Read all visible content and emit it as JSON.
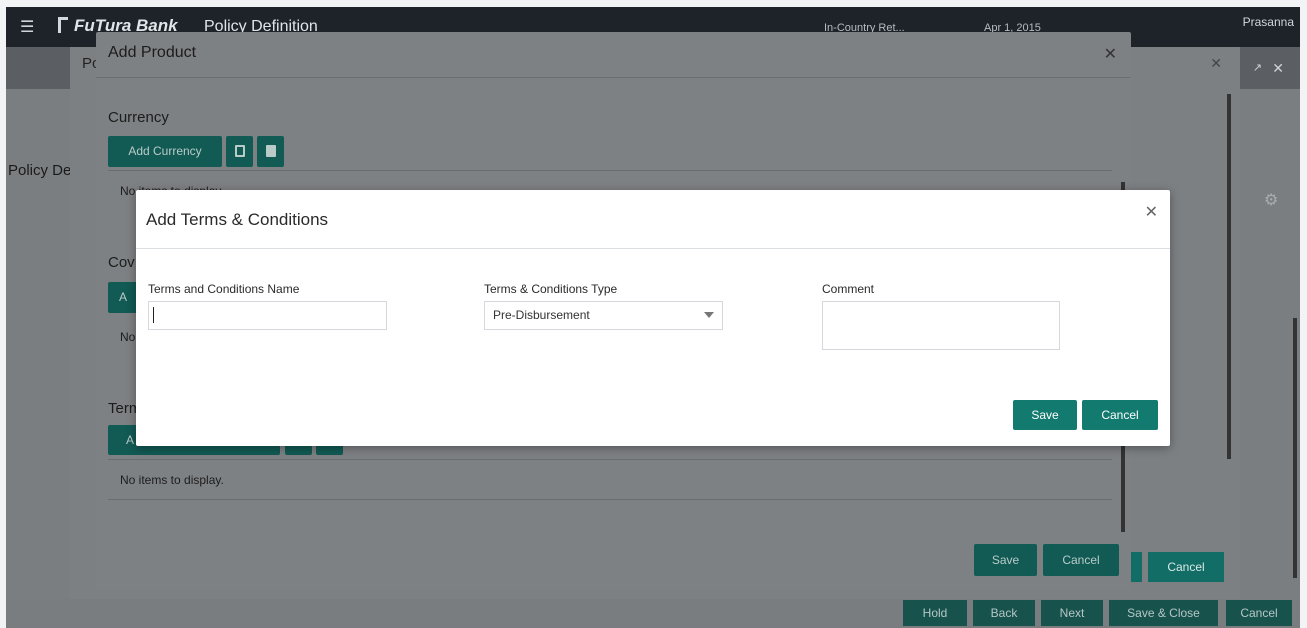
{
  "topbar": {
    "brand": "FuTura Bank",
    "title": "Policy Definition",
    "branch": "In-Country Ret...",
    "date": "Apr 1, 2015",
    "user": "Prasanna"
  },
  "page": {
    "left_label": "Policy De",
    "outer_modal_label": "Po"
  },
  "outer_modal": {
    "cancel_label": "Cancel"
  },
  "bottombar": {
    "hold": "Hold",
    "back": "Back",
    "next": "Next",
    "save_close": "Save & Close",
    "cancel": "Cancel"
  },
  "product_modal": {
    "title": "Add Product",
    "currency_label": "Currency",
    "add_currency": "Add Currency",
    "currency_empty": "No items to display.",
    "section2_label": "Cov",
    "section2_btn": "A",
    "section2_empty": "No",
    "section3_label": "Term",
    "section3_btn": "A",
    "section3_empty": "No items to display.",
    "save": "Save",
    "cancel": "Cancel"
  },
  "tc_modal": {
    "title": "Add Terms & Conditions",
    "name_label": "Terms and Conditions Name",
    "name_value": "",
    "type_label": "Terms & Conditions Type",
    "type_value": "Pre-Disbursement",
    "comment_label": "Comment",
    "comment_value": "",
    "save": "Save",
    "cancel": "Cancel"
  }
}
